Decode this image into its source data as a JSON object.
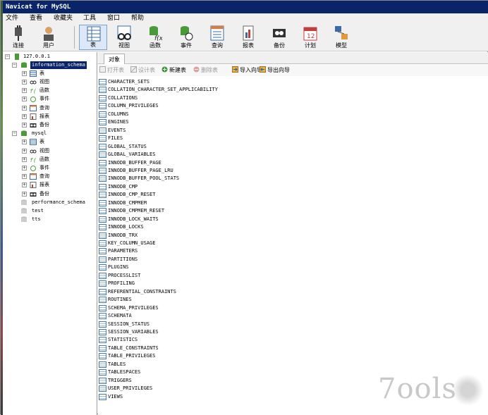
{
  "title": "Navicat for MySQL",
  "menu": [
    "文件",
    "查看",
    "收藏夹",
    "工具",
    "窗口",
    "帮助"
  ],
  "toolbar": [
    "连接",
    "用户",
    "表",
    "视图",
    "函数",
    "事件",
    "查询",
    "报表",
    "备份",
    "计划",
    "模型"
  ],
  "toolbar_active": "表",
  "tree": {
    "connection": "127.0.0.1",
    "databases": [
      {
        "name": "information_schema",
        "expanded": true,
        "selected": true,
        "children": [
          "表",
          "视图",
          "函数",
          "事件",
          "查询",
          "报表",
          "备份"
        ]
      },
      {
        "name": "mysql",
        "expanded": true,
        "children": [
          "表",
          "视图",
          "函数",
          "事件",
          "查询",
          "报表",
          "备份"
        ]
      },
      {
        "name": "performance_schema"
      },
      {
        "name": "test"
      },
      {
        "name": "tts"
      }
    ]
  },
  "tab": "对象",
  "object_toolbar": [
    {
      "label": "打开表",
      "enabled": false
    },
    {
      "label": "设计表",
      "enabled": false
    },
    {
      "label": "新建表",
      "enabled": true
    },
    {
      "label": "删除表",
      "enabled": false
    },
    {
      "label": "导入向导",
      "enabled": true
    },
    {
      "label": "导出向导",
      "enabled": true
    }
  ],
  "tables": [
    "CHARACTER_SETS",
    "COLLATION_CHARACTER_SET_APPLICABILITY",
    "COLLATIONS",
    "COLUMN_PRIVILEGES",
    "COLUMNS",
    "ENGINES",
    "EVENTS",
    "FILES",
    "GLOBAL_STATUS",
    "GLOBAL_VARIABLES",
    "INNODB_BUFFER_PAGE",
    "INNODB_BUFFER_PAGE_LRU",
    "INNODB_BUFFER_POOL_STATS",
    "INNODB_CMP",
    "INNODB_CMP_RESET",
    "INNODB_CMPMEM",
    "INNODB_CMPMEM_RESET",
    "INNODB_LOCK_WAITS",
    "INNODB_LOCKS",
    "INNODB_TRX",
    "KEY_COLUMN_USAGE",
    "PARAMETERS",
    "PARTITIONS",
    "PLUGINS",
    "PROCESSLIST",
    "PROFILING",
    "REFERENTIAL_CONSTRAINTS",
    "ROUTINES",
    "SCHEMA_PRIVILEGES",
    "SCHEMATA",
    "SESSION_STATUS",
    "SESSION_VARIABLES",
    "STATISTICS",
    "TABLE_CONSTRAINTS",
    "TABLE_PRIVILEGES",
    "TABLES",
    "TABLESPACES",
    "TRIGGERS",
    "USER_PRIVILEGES",
    "VIEWS"
  ],
  "watermark": "7ools"
}
